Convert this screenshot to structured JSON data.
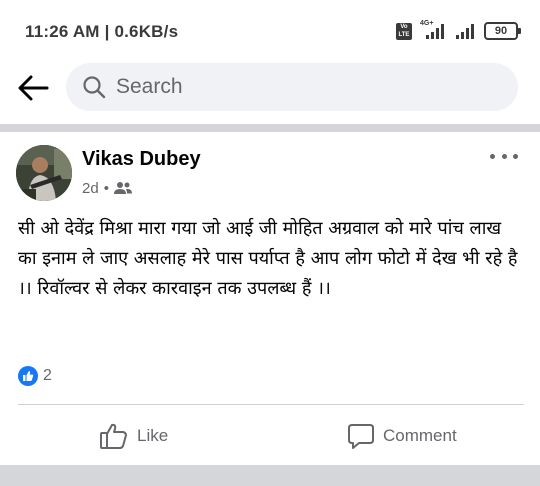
{
  "status_bar": {
    "time": "11:26 AM | 0.6KB/s",
    "volte_top": "Vo",
    "volte_bottom": "LTE",
    "network_label": "4G+",
    "battery": "90"
  },
  "search": {
    "placeholder": "Search"
  },
  "post": {
    "author": "Vikas Dubey",
    "age": "2d",
    "separator": "•",
    "audience_icon": "friends-icon",
    "text": "सी ओ देवेंद्र मिश्रा मारा गया जो आई जी मोहित अग्रवाल को मारे पांच लाख का इनाम ले जाए असलाह मेरे पास पर्याप्त है आप लोग फोटो में देख भी रहे है ।। रिवॉल्वर से लेकर कारवाइन तक उपलब्ध हैं ।।",
    "reaction_count": "2"
  },
  "actions": {
    "like_label": "Like",
    "comment_label": "Comment"
  },
  "colors": {
    "accent": "#1877f2",
    "secondary_text": "#65676b",
    "search_bg": "#f0f2f5",
    "divider": "#d4d6da"
  }
}
